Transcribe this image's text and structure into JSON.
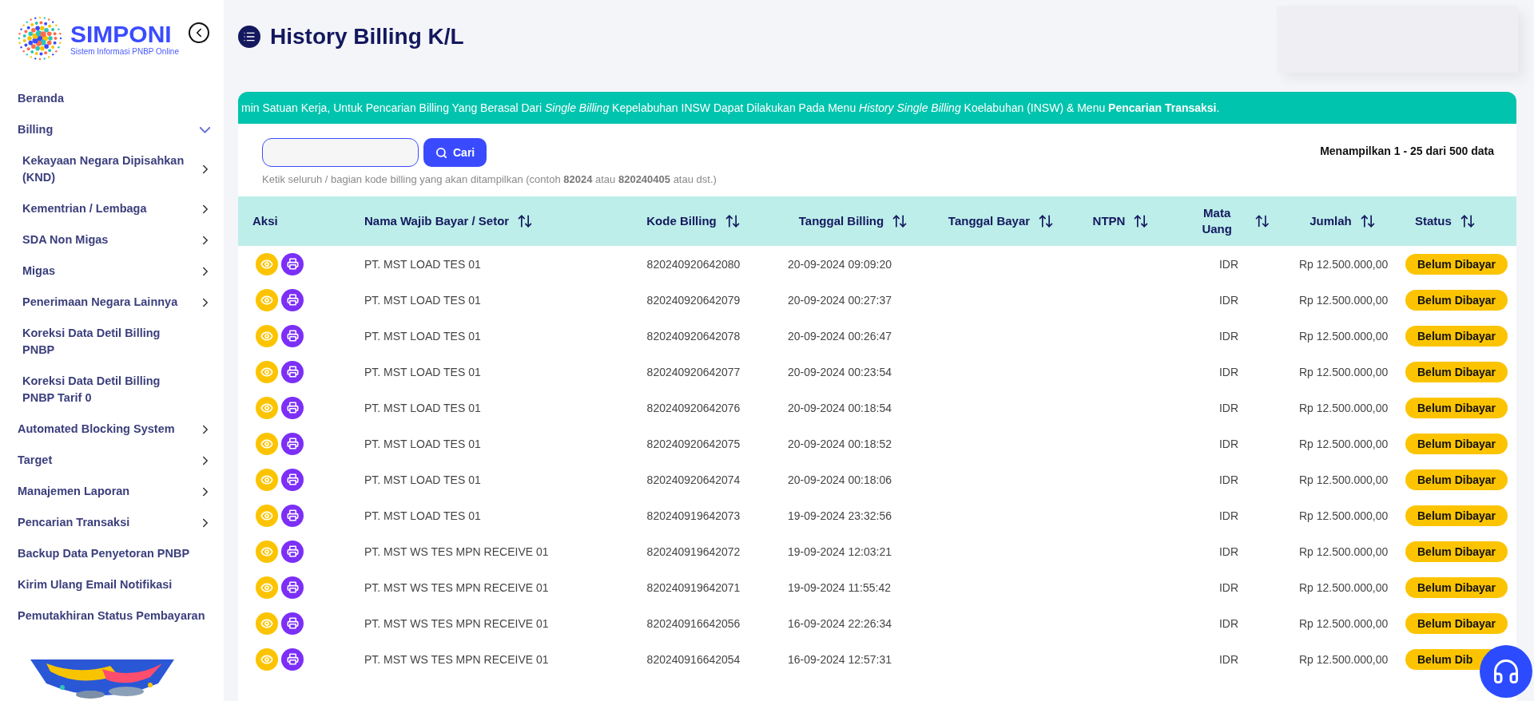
{
  "logo": {
    "name": "SIMPONI",
    "tagline": "Sistem Informasi PNBP Online"
  },
  "sidebar": {
    "items": [
      {
        "label": "Beranda"
      },
      {
        "label": "Billing",
        "expanded": true,
        "children": [
          {
            "label": "Kekayaan Negara Dipisahkan (KND)",
            "expanded": false
          },
          {
            "label": "Kementrian / Lembaga",
            "expanded": false
          },
          {
            "label": "SDA Non Migas",
            "expanded": false
          },
          {
            "label": "Migas",
            "expanded": false
          },
          {
            "label": "Penerimaan Negara Lainnya",
            "expanded": false
          },
          {
            "label": "Koreksi Data Detil Billing PNBP"
          },
          {
            "label": "Koreksi Data Detil Billing PNBP Tarif 0"
          }
        ]
      },
      {
        "label": "Automated Blocking System",
        "expanded": false
      },
      {
        "label": "Target",
        "expanded": false
      },
      {
        "label": "Manajemen Laporan",
        "expanded": false
      },
      {
        "label": "Pencarian Transaksi",
        "expanded": false
      },
      {
        "label": "Backup Data Penyetoran PNBP"
      },
      {
        "label": "Kirim Ulang Email Notifikasi"
      },
      {
        "label": "Pemutakhiran Status Pembayaran"
      }
    ]
  },
  "page": {
    "title": "History Billing K/L"
  },
  "banner": "min Satuan Kerja, Untuk Pencarian Billing Yang Berasal Dari *Single Billing* Kepelabuhan INSW Dapat Dilakukan Pada Menu *History Single Billing* Koelabuhan (INSW) & Menu **Pencarian Transaksi**.",
  "search": {
    "button": "Cari",
    "hint": "Ketik seluruh / bagian kode billing yang akan ditampilkan (contoh **82024** atau **820240405** atau dst.)"
  },
  "summary": "Menampilkan 1 - 25 dari 500 data",
  "table": {
    "columns": [
      {
        "label": "Aksi",
        "sortable": false
      },
      {
        "label": "Nama Wajib Bayar / Setor",
        "sortable": true
      },
      {
        "label": "Kode Billing",
        "sortable": true
      },
      {
        "label": "Tanggal Billing",
        "sortable": true
      },
      {
        "label": "Tanggal Bayar",
        "sortable": true
      },
      {
        "label": "NTPN",
        "sortable": true
      },
      {
        "label": "Mata Uang",
        "sortable": true
      },
      {
        "label": "Jumlah",
        "sortable": true
      },
      {
        "label": "Status",
        "sortable": true
      }
    ],
    "rows": [
      {
        "name": "PT. MST LOAD TES 01",
        "code": "820240920642080",
        "billed": "20-09-2024 09:09:20",
        "currency": "IDR",
        "amount": "Rp 12.500.000,00",
        "status": "Belum Dibayar"
      },
      {
        "name": "PT. MST LOAD TES 01",
        "code": "820240920642079",
        "billed": "20-09-2024 00:27:37",
        "currency": "IDR",
        "amount": "Rp 12.500.000,00",
        "status": "Belum Dibayar"
      },
      {
        "name": "PT. MST LOAD TES 01",
        "code": "820240920642078",
        "billed": "20-09-2024 00:26:47",
        "currency": "IDR",
        "amount": "Rp 12.500.000,00",
        "status": "Belum Dibayar"
      },
      {
        "name": "PT. MST LOAD TES 01",
        "code": "820240920642077",
        "billed": "20-09-2024 00:23:54",
        "currency": "IDR",
        "amount": "Rp 12.500.000,00",
        "status": "Belum Dibayar"
      },
      {
        "name": "PT. MST LOAD TES 01",
        "code": "820240920642076",
        "billed": "20-09-2024 00:18:54",
        "currency": "IDR",
        "amount": "Rp 12.500.000,00",
        "status": "Belum Dibayar"
      },
      {
        "name": "PT. MST LOAD TES 01",
        "code": "820240920642075",
        "billed": "20-09-2024 00:18:52",
        "currency": "IDR",
        "amount": "Rp 12.500.000,00",
        "status": "Belum Dibayar"
      },
      {
        "name": "PT. MST LOAD TES 01",
        "code": "820240920642074",
        "billed": "20-09-2024 00:18:06",
        "currency": "IDR",
        "amount": "Rp 12.500.000,00",
        "status": "Belum Dibayar"
      },
      {
        "name": "PT. MST LOAD TES 01",
        "code": "820240919642073",
        "billed": "19-09-2024 23:32:56",
        "currency": "IDR",
        "amount": "Rp 12.500.000,00",
        "status": "Belum Dibayar"
      },
      {
        "name": "PT. MST WS TES MPN RECEIVE 01",
        "code": "820240919642072",
        "billed": "19-09-2024 12:03:21",
        "currency": "IDR",
        "amount": "Rp 12.500.000,00",
        "status": "Belum Dibayar"
      },
      {
        "name": "PT. MST WS TES MPN RECEIVE 01",
        "code": "820240919642071",
        "billed": "19-09-2024 11:55:42",
        "currency": "IDR",
        "amount": "Rp 12.500.000,00",
        "status": "Belum Dibayar"
      },
      {
        "name": "PT. MST WS TES MPN RECEIVE 01",
        "code": "820240916642056",
        "billed": "16-09-2024 22:26:34",
        "currency": "IDR",
        "amount": "Rp 12.500.000,00",
        "status": "Belum Dibayar"
      },
      {
        "name": "PT. MST WS TES MPN RECEIVE 01",
        "code": "820240916642054",
        "billed": "16-09-2024 12:57:31",
        "currency": "IDR",
        "amount": "Rp 12.500.000,00",
        "status": "Belum Dib"
      }
    ]
  }
}
